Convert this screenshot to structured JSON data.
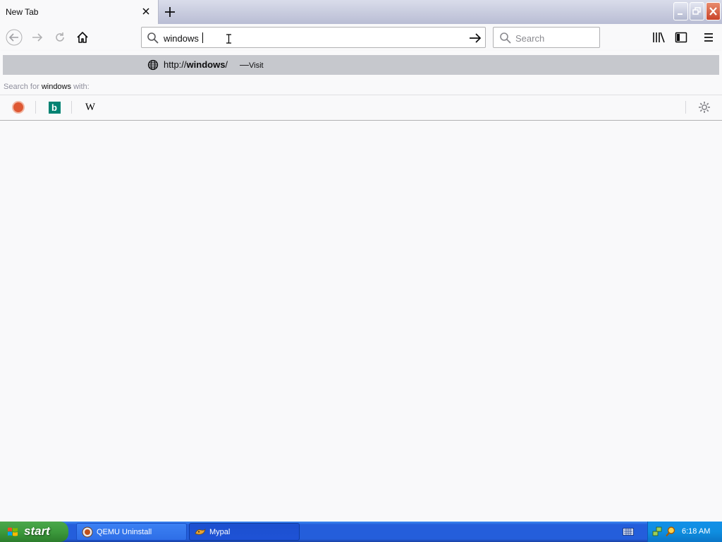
{
  "tab": {
    "title": "New Tab"
  },
  "urlbar": {
    "value": "windows"
  },
  "searchbar": {
    "placeholder": "Search"
  },
  "popup": {
    "result": {
      "url_prefix": "http://",
      "url_host": "windows",
      "url_suffix": "/",
      "separator": "—",
      "action": "Visit"
    },
    "search_with": {
      "prefix": "Search for",
      "query": "windows",
      "suffix": "with:"
    },
    "engines": [
      {
        "name": "DuckDuckGo",
        "icon": "duckduckgo-icon"
      },
      {
        "name": "Bing",
        "icon": "bing-icon",
        "glyph": "b"
      },
      {
        "name": "Wikipedia",
        "icon": "wikipedia-icon",
        "glyph": "W"
      }
    ]
  },
  "taskbar": {
    "start_label": "start",
    "tasks": [
      {
        "label": "QEMU Uninstall",
        "active": false
      },
      {
        "label": "Mypal",
        "active": true
      }
    ],
    "clock": "6:18 AM"
  },
  "colors": {
    "popup_highlight": "#c6c8cd",
    "taskbar_blue": "#245edb",
    "start_green": "#3c9a3c",
    "tray_blue": "#0f8ee0"
  }
}
